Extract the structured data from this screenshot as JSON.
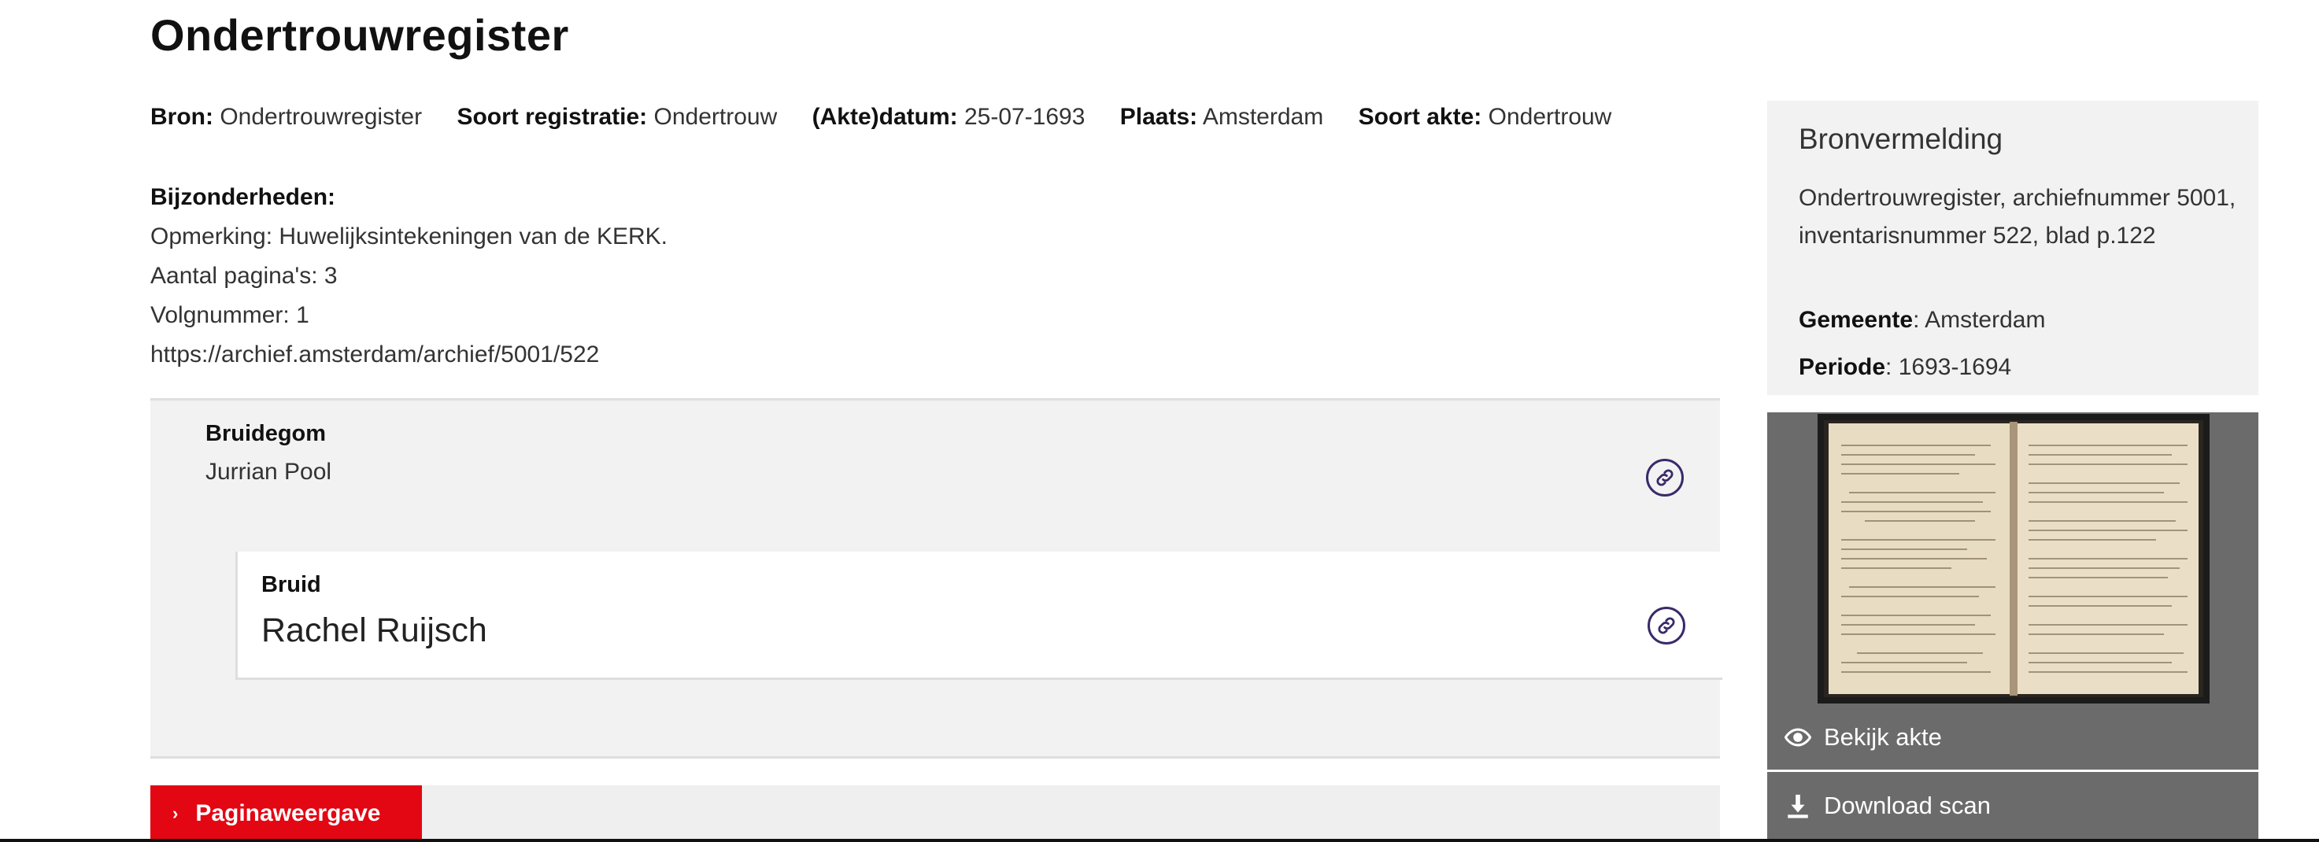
{
  "page": {
    "title": "Ondertrouwregister"
  },
  "meta": [
    {
      "label": "Bron:",
      "value": "Ondertrouwregister"
    },
    {
      "label": "Soort registratie:",
      "value": "Ondertrouw"
    },
    {
      "label": "(Akte)datum:",
      "value": "25-07-1693"
    },
    {
      "label": "Plaats:",
      "value": "Amsterdam"
    },
    {
      "label": "Soort akte:",
      "value": "Ondertrouw"
    }
  ],
  "details": {
    "heading": "Bijzonderheden:",
    "lines": [
      "Opmerking: Huwelijksintekeningen van de KERK.",
      "Aantal pagina's: 3",
      "Volgnummer: 1",
      "https://archief.amsterdam/archief/5001/522"
    ]
  },
  "persons": {
    "groom": {
      "role": "Bruidegom",
      "name": "Jurrian Pool"
    },
    "bride": {
      "role": "Bruid",
      "name": "Rachel Ruijsch"
    }
  },
  "bottom": {
    "page_button": "Paginaweergave"
  },
  "sidebar": {
    "title": "Bronvermelding",
    "citation": "Ondertrouwregister, archiefnummer 5001, inventarisnummer 522, blad p.122",
    "gemeente_label": "Gemeente",
    "gemeente_value": ": Amsterdam",
    "periode_label": "Periode",
    "periode_value": ": 1693-1694"
  },
  "scan": {
    "view_label": "Bekijk akte",
    "download_label": "Download scan"
  },
  "icons": {
    "link": "link-icon",
    "eye": "eye-icon",
    "download": "download-icon",
    "chevron": "chevron-right-icon"
  },
  "colors": {
    "accent_red": "#e30613",
    "link_purple": "#3a2a6a",
    "panel_gray": "#6b6b6b"
  }
}
